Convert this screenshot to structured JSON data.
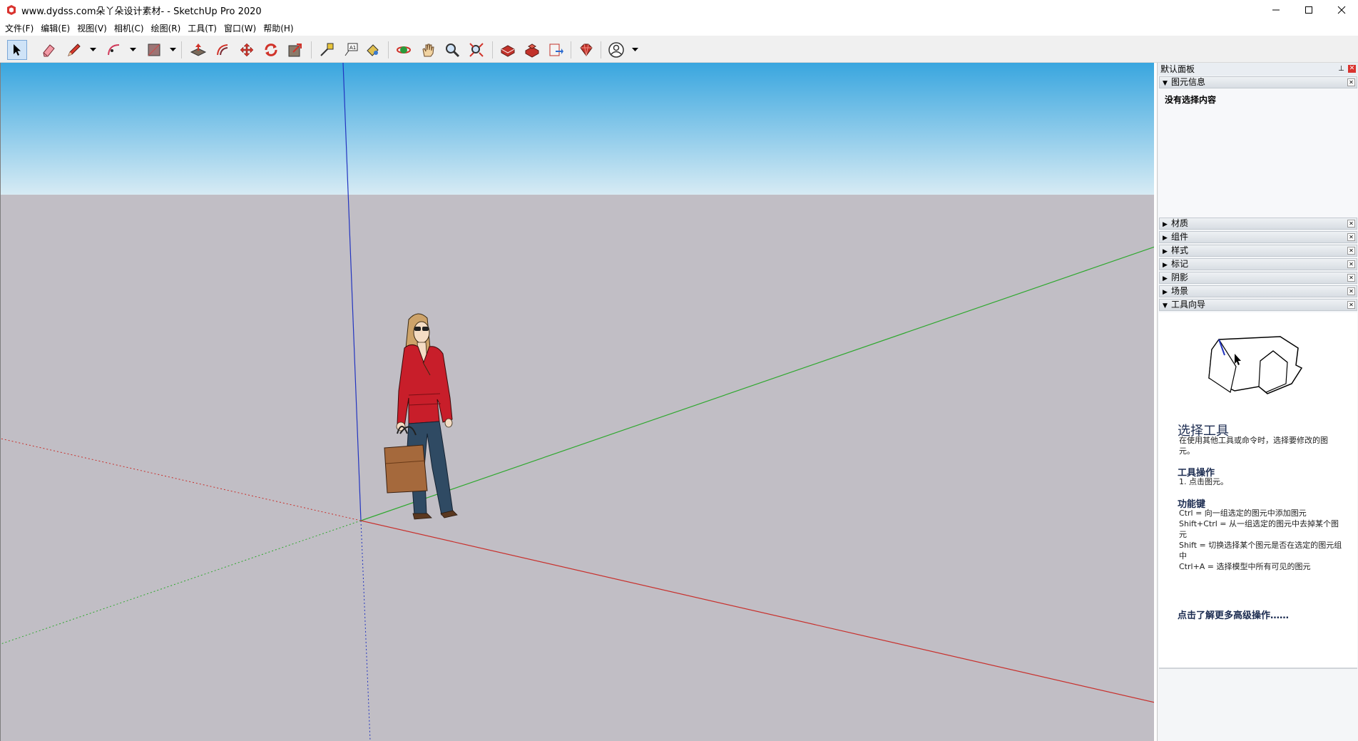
{
  "window": {
    "title": "www.dydss.com朵丫朵设计素材- - SketchUp Pro 2020",
    "controls": [
      "minimize-icon",
      "maximize-icon",
      "close-icon"
    ]
  },
  "menu": {
    "items": [
      "文件(F)",
      "编辑(E)",
      "视图(V)",
      "相机(C)",
      "绘图(R)",
      "工具(T)",
      "窗口(W)",
      "帮助(H)"
    ]
  },
  "toolbar": {
    "tools": [
      "select-tool-icon",
      "eraser-tool-icon",
      "pencil-line-tool-icon",
      "arc-tool-icon",
      "rectangle-tool-icon",
      "push-pull-tool-icon",
      "offset-tool-icon",
      "move-tool-icon",
      "rotate-tool-icon",
      "scale-tool-icon",
      "tape-measure-tool-icon",
      "text-tool-icon",
      "paint-bucket-tool-icon",
      "orbit-tool-icon",
      "pan-tool-icon",
      "zoom-tool-icon",
      "zoom-extents-tool-icon",
      "3d-warehouse-icon",
      "extension-warehouse-icon",
      "send-to-layout-icon",
      "extension-manager-icon",
      "account-icon"
    ],
    "active_tool": "select-tool-icon"
  },
  "panel": {
    "title": "默认面板",
    "entity_info": {
      "label": "图元信息",
      "expanded": true,
      "content": "没有选择内容"
    },
    "trays": [
      {
        "label": "材质",
        "expanded": false
      },
      {
        "label": "组件",
        "expanded": false
      },
      {
        "label": "样式",
        "expanded": false
      },
      {
        "label": "标记",
        "expanded": false
      },
      {
        "label": "阴影",
        "expanded": false
      },
      {
        "label": "场景",
        "expanded": false
      },
      {
        "label": "工具向导",
        "expanded": true
      }
    ],
    "instructor": {
      "title": "选择工具",
      "description": "在使用其他工具或命令时，选择要修改的图元。",
      "operations_heading": "工具操作",
      "operations": "1. 点击图元。",
      "modifier_heading": "功能键",
      "modifiers": [
        "Ctrl = 向一组选定的图元中添加图元",
        "Shift+Ctrl = 从一组选定的图元中去掉某个图元",
        "Shift = 切换选择某个图元是否在选定的图元组中",
        "Ctrl+A = 选择模型中所有可见的图元"
      ],
      "more_link": "点击了解更多高级操作……"
    }
  },
  "colors": {
    "sky_top": "#3aa6df",
    "sky_bottom": "#d3e9f3",
    "ground": "#c1bec5",
    "axis_red": "#c8302c",
    "axis_green": "#2fa82f",
    "axis_blue": "#2234c0",
    "shirt_red": "#c81e2a",
    "pants": "#2f4a63",
    "bag": "#a5693c"
  }
}
